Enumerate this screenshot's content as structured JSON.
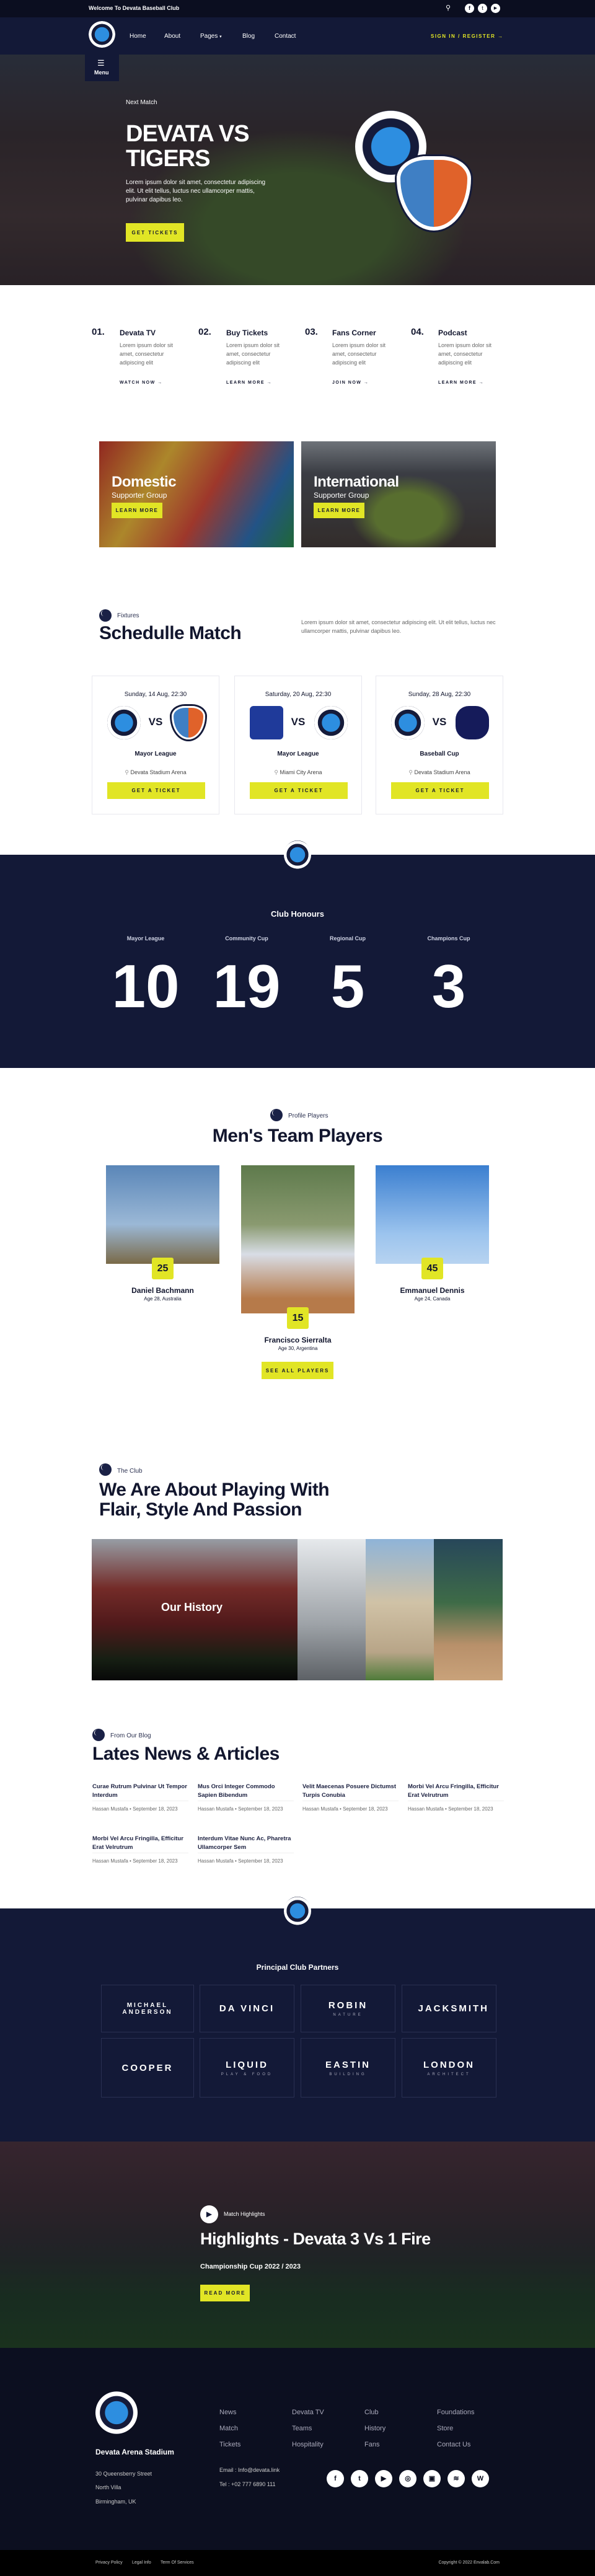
{
  "topbar": {
    "welcome": "Welcome To Devata Baseball Club",
    "icons": [
      "search-icon",
      "facebook-icon",
      "twitter-icon",
      "youtube-icon"
    ]
  },
  "nav": {
    "items": [
      "Home",
      "About",
      "Pages",
      "Blog",
      "Contact"
    ],
    "pages_caret": "▾",
    "signin": "SIGN IN / REGISTER",
    "signin_arrow": "→",
    "menu_label": "Menu",
    "menu_icon": "☰"
  },
  "hero": {
    "kicker": "Next Match",
    "title_line1": "DEVATA VS",
    "title_line2": "TIGERS",
    "description": "Lorem ipsum dolor sit amet, consectetur adipiscing elit. Ut elit tellus, luctus nec ullamcorper mattis, pulvinar dapibus leo.",
    "button": "GET TICKETS"
  },
  "features": [
    {
      "num": "01.",
      "title": "Devata TV",
      "desc": "Lorem ipsum dolor sit amet, consectetur adipiscing elit",
      "link": "WATCH NOW"
    },
    {
      "num": "02.",
      "title": "Buy Tickets",
      "desc": "Lorem ipsum dolor sit amet, consectetur adipiscing elit",
      "link": "LEARN MORE"
    },
    {
      "num": "03.",
      "title": "Fans Corner",
      "desc": "Lorem ipsum dolor sit amet, consectetur adipiscing elit",
      "link": "JOIN NOW"
    },
    {
      "num": "04.",
      "title": "Podcast",
      "desc": "Lorem ipsum dolor sit amet, consectetur adipiscing elit",
      "link": "LEARN MORE"
    }
  ],
  "supporters": [
    {
      "title": "Domestic",
      "subtitle": "Supporter Group",
      "button": "LEARN MORE"
    },
    {
      "title": "International",
      "subtitle": "Supporter Group",
      "button": "LEARN MORE"
    }
  ],
  "fixtures": {
    "kicker": "Fixtures",
    "title": "Schedulle Match",
    "description": "Lorem ipsum dolor sit amet, consectetur adipiscing elit. Ut elit tellus, luctus nec ullamcorper mattis, pulvinar dapibus leo.",
    "vs": "VS",
    "matches": [
      {
        "date": "Sunday, 14 Aug, 22:30",
        "league": "Mayor League",
        "venue": "Devata Stadium Arena",
        "button": "GET A TICKET"
      },
      {
        "date": "Saturday, 20 Aug, 22:30",
        "league": "Mayor League",
        "venue": "Miami City Arena",
        "button": "GET A TICKET"
      },
      {
        "date": "Sunday, 28 Aug, 22:30",
        "league": "Baseball Cup",
        "venue": "Devata Stadium Arena",
        "button": "GET A TICKET"
      }
    ]
  },
  "honours": {
    "title": "Club Honours",
    "items": [
      {
        "label": "Mayor League",
        "value": "10"
      },
      {
        "label": "Community Cup",
        "value": "19"
      },
      {
        "label": "Regional Cup",
        "value": "5"
      },
      {
        "label": "Champions Cup",
        "value": "3"
      }
    ]
  },
  "players": {
    "kicker": "Profile Players",
    "title": "Men's Team Players",
    "button": "SEE ALL PLAYERS",
    "list": [
      {
        "number": "25",
        "name": "Daniel Bachmann",
        "info": "Age 28, Australia"
      },
      {
        "number": "15",
        "name": "Francisco Sierralta",
        "info": "Age 30, Argentina"
      },
      {
        "number": "45",
        "name": "Emmanuel Dennis",
        "info": "Age 24, Canada"
      }
    ]
  },
  "club": {
    "kicker": "The Club",
    "title_line1": "We Are About Playing With",
    "title_line2": "Flair, Style And Passion",
    "gallery_label": "Our History"
  },
  "blog": {
    "kicker": "From Our Blog",
    "title": "Lates News & Articles",
    "separator": "•",
    "articles": [
      {
        "title": "Curae Rutrum Pulvinar Ut Tempor Interdum",
        "author": "Hassan Mustafa",
        "date": "September 18, 2023"
      },
      {
        "title": "Mus Orci Integer Commodo Sapien Bibendum",
        "author": "Hassan Mustafa",
        "date": "September 18, 2023"
      },
      {
        "title": "Velit Maecenas Posuere Dictumst Turpis Conubia",
        "author": "Hassan Mustafa",
        "date": "September 18, 2023"
      },
      {
        "title": "Morbi Vel Arcu Fringilla, Efficitur Erat Velrutrum",
        "author": "Hassan Mustafa",
        "date": "September 18, 2023"
      },
      {
        "title": "Morbi Vel Arcu Fringilla, Efficitur Erat Velrutrum",
        "author": "Hassan Mustafa",
        "date": "September 18, 2023"
      },
      {
        "title": "Interdum Vitae Nunc Ac, Pharetra Ullamcorper Sem",
        "author": "Hassan Mustafa",
        "date": "September 18, 2023"
      }
    ]
  },
  "partners": {
    "title": "Principal Club Partners",
    "logos": [
      {
        "main": "MICHAEL ANDERSON",
        "sub": ""
      },
      {
        "main": "DA VINCI",
        "sub": ""
      },
      {
        "main": "ROBIN",
        "sub": "NATURE"
      },
      {
        "main": "JACKSMITH",
        "sub": ""
      },
      {
        "main": "COOPER",
        "sub": ""
      },
      {
        "main": "LIQUID",
        "sub": "PLAY & FOOD"
      },
      {
        "main": "EASTIN",
        "sub": "BUILDING"
      },
      {
        "main": "LONDON",
        "sub": "ARCHITECT"
      }
    ]
  },
  "highlights": {
    "kicker": "Match Highlights",
    "title": "Highlights - Devata 3 Vs 1 Fire",
    "subtitle": "Championship Cup 2022 / 2023",
    "button": "READ MORE"
  },
  "footer": {
    "stadium": "Devata Arena Stadium",
    "address": [
      "30 Queensberry Street",
      "North Villa",
      "Birmingham, UK"
    ],
    "links": [
      [
        "News",
        "Match",
        "Tickets"
      ],
      [
        "Devata TV",
        "Teams",
        "Hospitality"
      ],
      [
        "Club",
        "History",
        "Fans"
      ],
      [
        "Foundations",
        "Store",
        "Contact Us"
      ]
    ],
    "email": "Email : Info@devata.link",
    "tel": "Tel : +02 777 6890 111",
    "social": [
      "f",
      "t",
      "▶",
      "◎",
      "▣",
      "≋",
      "W"
    ],
    "bottom_links": [
      "Privacy Policy",
      "Legal Info",
      "Term Of Services"
    ],
    "copyright": "Copyright © 2022 Envalab.Com"
  },
  "colors": {
    "navy": "#131937",
    "accent": "#e1e525",
    "topbar": "#0b0e20",
    "footer": "#0c0f20"
  }
}
